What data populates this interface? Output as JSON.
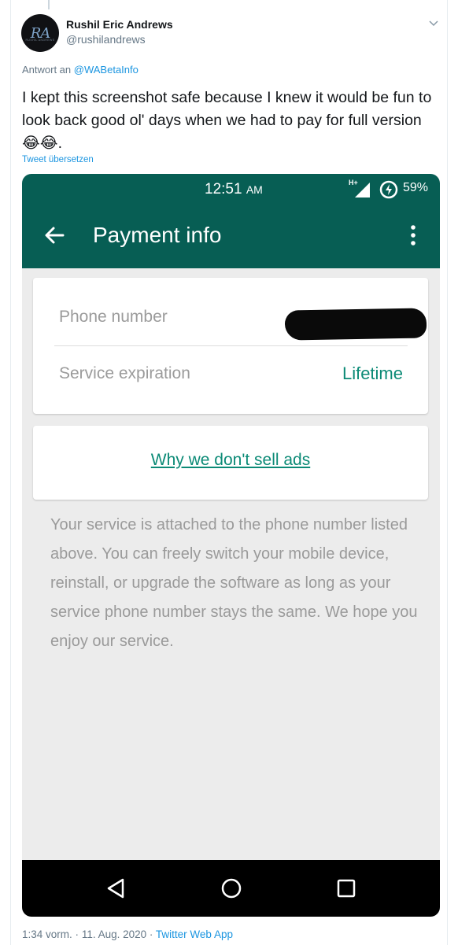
{
  "tweet": {
    "author_name": "Rushil Eric Andrews",
    "author_handle": "@rushilandrews",
    "avatar_initials": "RA",
    "avatar_subtext": "RUSHIL ANDREWS",
    "reply_prefix": "Antwort an",
    "reply_to": "@WABetaInfo",
    "text": "I kept this screenshot safe because I knew it would be fun to look back good ol' days when we had to pay for full version",
    "emojis": "😂😂",
    "text_suffix": ".",
    "translate_label": "Tweet übersetzen",
    "time": "1:34 vorm.",
    "separator": "·",
    "date": "11. Aug. 2020",
    "source": "Twitter Web App"
  },
  "phone": {
    "status_time": "12:51",
    "status_ampm": "AM",
    "network_label": "H+",
    "battery_percent": "59%",
    "header_title": "Payment info",
    "phone_number_label": "Phone number",
    "service_expiration_label": "Service expiration",
    "service_expiration_value": "Lifetime",
    "ads_link": "Why we don't sell ads",
    "info_text": "Your service is attached to the phone number listed above. You can freely switch your mobile device, reinstall, or upgrade the software as long as your service phone number stays the same. We hope you enjoy our service."
  },
  "icons": {
    "caret": "chevron-down-icon",
    "back": "arrow-left-icon",
    "more": "more-vert-icon",
    "nav_back": "triangle-back-icon",
    "nav_home": "circle-home-icon",
    "nav_recents": "square-recents-icon"
  },
  "colors": {
    "whatsapp_header": "#075e54",
    "teal_accent": "#0b8a76",
    "twitter_blue": "#1b95e0",
    "screen_bg": "#ececec"
  }
}
